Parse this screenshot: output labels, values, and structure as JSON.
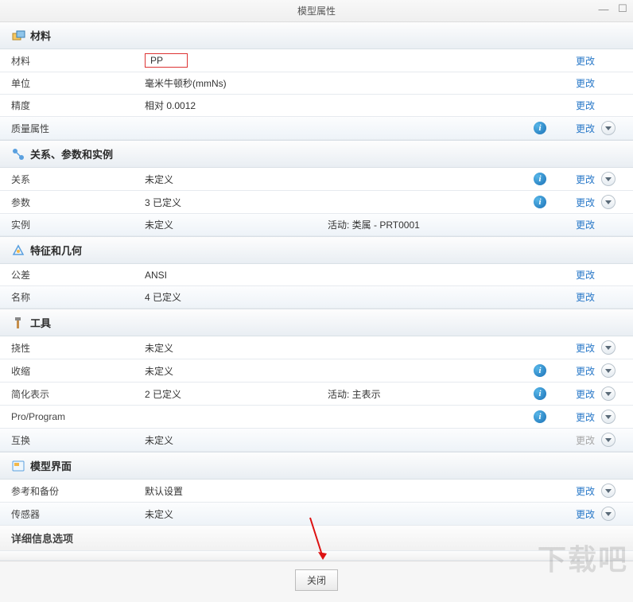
{
  "window": {
    "title": "模型属性"
  },
  "actions": {
    "change": "更改",
    "change_disabled": "更改"
  },
  "sections": [
    {
      "key": "material",
      "title": "材料",
      "rows": [
        {
          "label": "材料",
          "value": "PP",
          "highlighted": true,
          "action": "change"
        },
        {
          "label": "单位",
          "value": "毫米牛顿秒(mmNs)",
          "action": "change"
        },
        {
          "label": "精度",
          "value": "相对 0.0012",
          "action": "change"
        },
        {
          "label": "质量属性",
          "value": "",
          "info": true,
          "action": "change",
          "expand": true,
          "alt": true
        }
      ]
    },
    {
      "key": "relations",
      "title": "关系、参数和实例",
      "rows": [
        {
          "label": "关系",
          "value": "未定义",
          "info": true,
          "action": "change",
          "expand": true
        },
        {
          "label": "参数",
          "value": "3 已定义",
          "info": true,
          "action": "change",
          "expand": true
        },
        {
          "label": "实例",
          "value": "未定义",
          "extra": "活动: 类属 - PRT0001",
          "action": "change",
          "alt": true
        }
      ]
    },
    {
      "key": "feature",
      "title": "特征和几何",
      "rows": [
        {
          "label": "公差",
          "value": "ANSI",
          "action": "change"
        },
        {
          "label": "名称",
          "value": "4 已定义",
          "action": "change",
          "alt": true
        }
      ]
    },
    {
      "key": "tools",
      "title": "工具",
      "rows": [
        {
          "label": "挠性",
          "value": "未定义",
          "action": "change",
          "expand": true
        },
        {
          "label": "收缩",
          "value": "未定义",
          "info": true,
          "action": "change",
          "expand": true
        },
        {
          "label": "简化表示",
          "value": "2 已定义",
          "extra": "活动: 主表示",
          "info": true,
          "action": "change",
          "expand": true
        },
        {
          "label": "Pro/Program",
          "value": "",
          "info": true,
          "action": "change",
          "expand": true
        },
        {
          "label": "互换",
          "value": "未定义",
          "action": "change_disabled",
          "expand": true,
          "alt": true
        }
      ]
    },
    {
      "key": "interface",
      "title": "模型界面",
      "rows": [
        {
          "label": "参考和备份",
          "value": "默认设置",
          "action": "change",
          "expand": true
        },
        {
          "label": "传感器",
          "value": "未定义",
          "action": "change",
          "expand": true,
          "alt": true
        }
      ]
    }
  ],
  "footer": {
    "close": "关闭"
  },
  "detail_label": "详细信息选项",
  "truncated_label": "详细信息选项",
  "watermark": "下载吧"
}
